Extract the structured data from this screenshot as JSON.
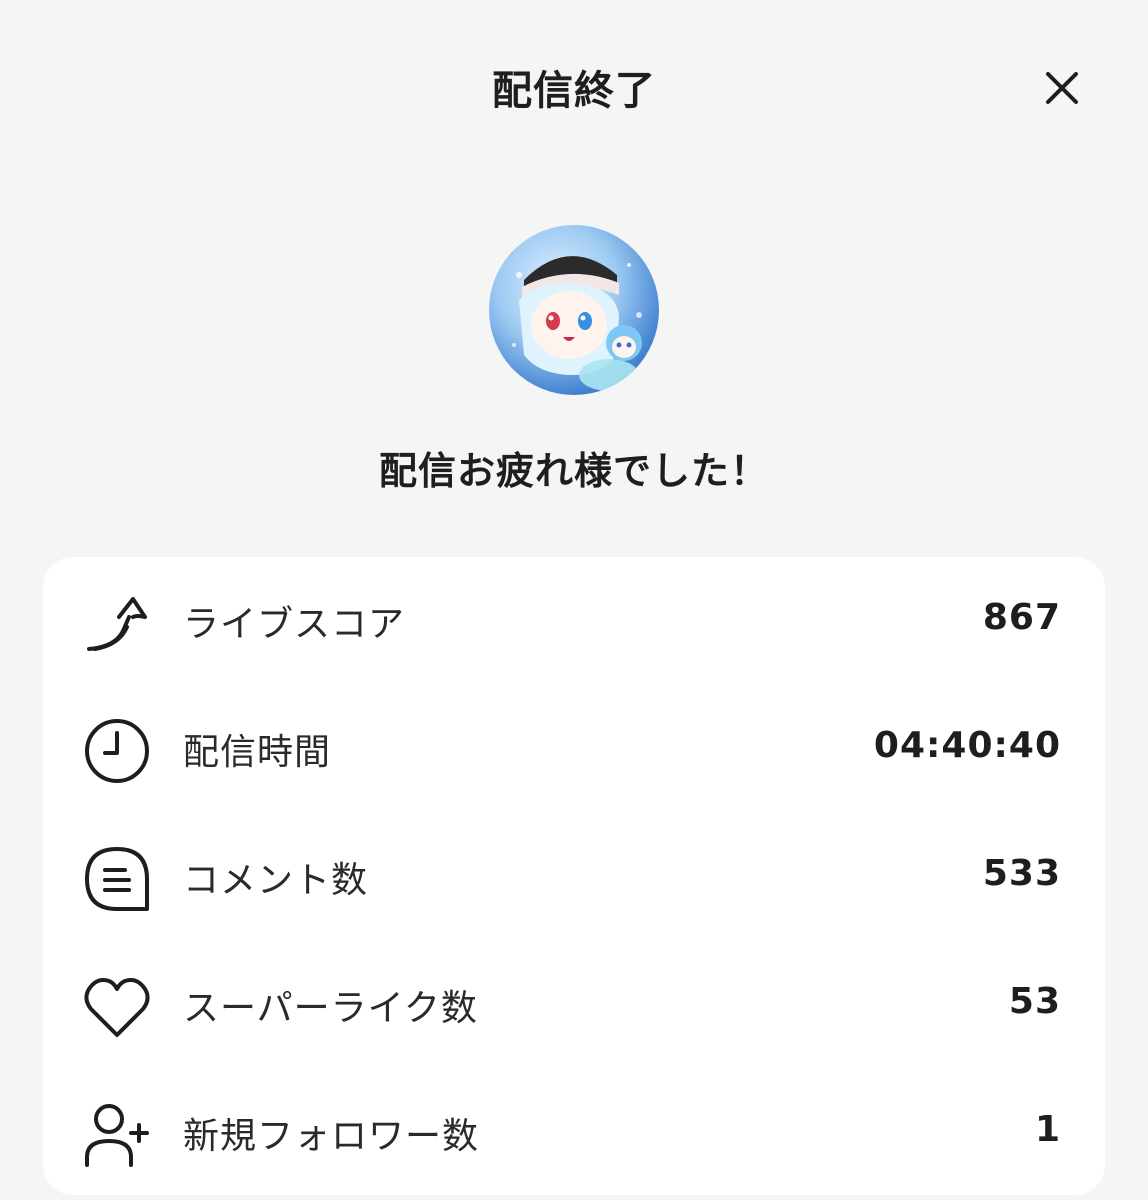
{
  "header": {
    "title": "配信終了"
  },
  "avatar": {
    "description": "avatar"
  },
  "message": "配信お疲れ様でした！",
  "stats": [
    {
      "icon": "arrow-up-icon",
      "label": "ライブスコア",
      "value": "867"
    },
    {
      "icon": "clock-icon",
      "label": "配信時間",
      "value": "04:40:40"
    },
    {
      "icon": "comment-icon",
      "label": "コメント数",
      "value": "533"
    },
    {
      "icon": "heart-icon",
      "label": "スーパーライク数",
      "value": "53"
    },
    {
      "icon": "add-user-icon",
      "label": "新規フォロワー数",
      "value": "1"
    }
  ],
  "colors": {
    "background": "#f5f5f5",
    "card": "#ffffff",
    "text": "#1e1e1e"
  }
}
